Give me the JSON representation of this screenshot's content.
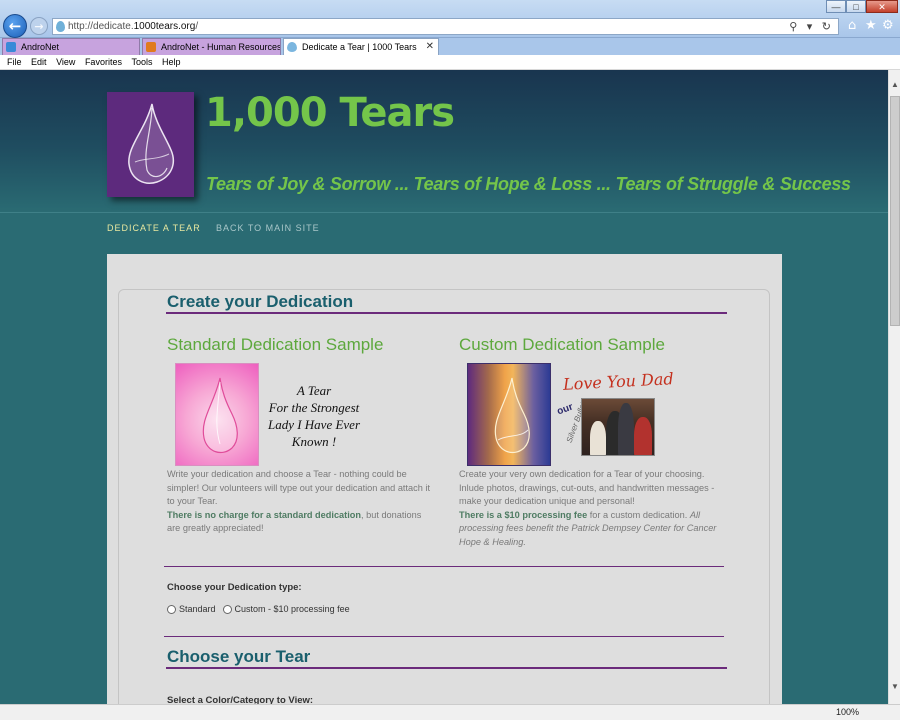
{
  "browser": {
    "address": {
      "prefix": "http://dedicate.",
      "host": "1000tears.org",
      "suffix": "/",
      "tools": "⚲ ▾ ↻"
    },
    "window_controls": {
      "minimize": "—",
      "maximize": "□",
      "close": "✕"
    },
    "right_icons": {
      "home": "⌂",
      "favorites": "★",
      "tools": "⚙"
    },
    "tabs": [
      {
        "label": "AndroNet",
        "icon": "ie-icon"
      },
      {
        "label": "AndroNet - Human Resources:...",
        "icon": "a-icon"
      },
      {
        "label": "Dedicate a Tear | 1000 Tears",
        "icon": "tear-icon",
        "close": "✕"
      }
    ],
    "menu": [
      "File",
      "Edit",
      "View",
      "Favorites",
      "Tools",
      "Help"
    ],
    "zoom": "100%"
  },
  "site": {
    "title": "1,000 Tears",
    "tagline": "Tears of Joy & Sorrow ... Tears of Hope & Loss ... Tears of Struggle & Success",
    "nav": [
      "DEDICATE A TEAR",
      "BACK TO MAIN SITE"
    ]
  },
  "content": {
    "create_heading": "Create your Dedication",
    "standard": {
      "heading": "Standard Dedication Sample",
      "sample_text": [
        "A Tear",
        "For the Strongest",
        "Lady I Have Ever",
        "Known !"
      ],
      "desc": "Write your dedication and choose a Tear - nothing could be simpler! Our volunteers will type out your dedication and attach it to your Tear.",
      "bold": "There is no charge for a standard dedication",
      "rest": ", but donations are greatly appreciated!"
    },
    "custom": {
      "heading": "Custom Dedication Sample",
      "love": "Love You Dad",
      "our": "our",
      "silver": "Silver Bullet",
      "desc": "Create your very own dedication for a Tear of your choosing. Inlude photos, drawings, cut-outs, and handwritten messages - make your dedication unique and personal!",
      "bold": "There is a $10 processing fee",
      "rest": " for a custom dedication. ",
      "italic": "All processing fees benefit the Patrick Dempsey Center for Cancer Hope & Healing."
    },
    "type_label": "Choose your Dedication type:",
    "options": [
      "Standard",
      "Custom - $10 processing fee"
    ],
    "tear_heading": "Choose your Tear",
    "select_label": "Select a Color/Category to View:"
  },
  "colors": {
    "brand_green": "#74c54a",
    "teal": "#2a6b73",
    "purple": "#6b2b7b"
  }
}
